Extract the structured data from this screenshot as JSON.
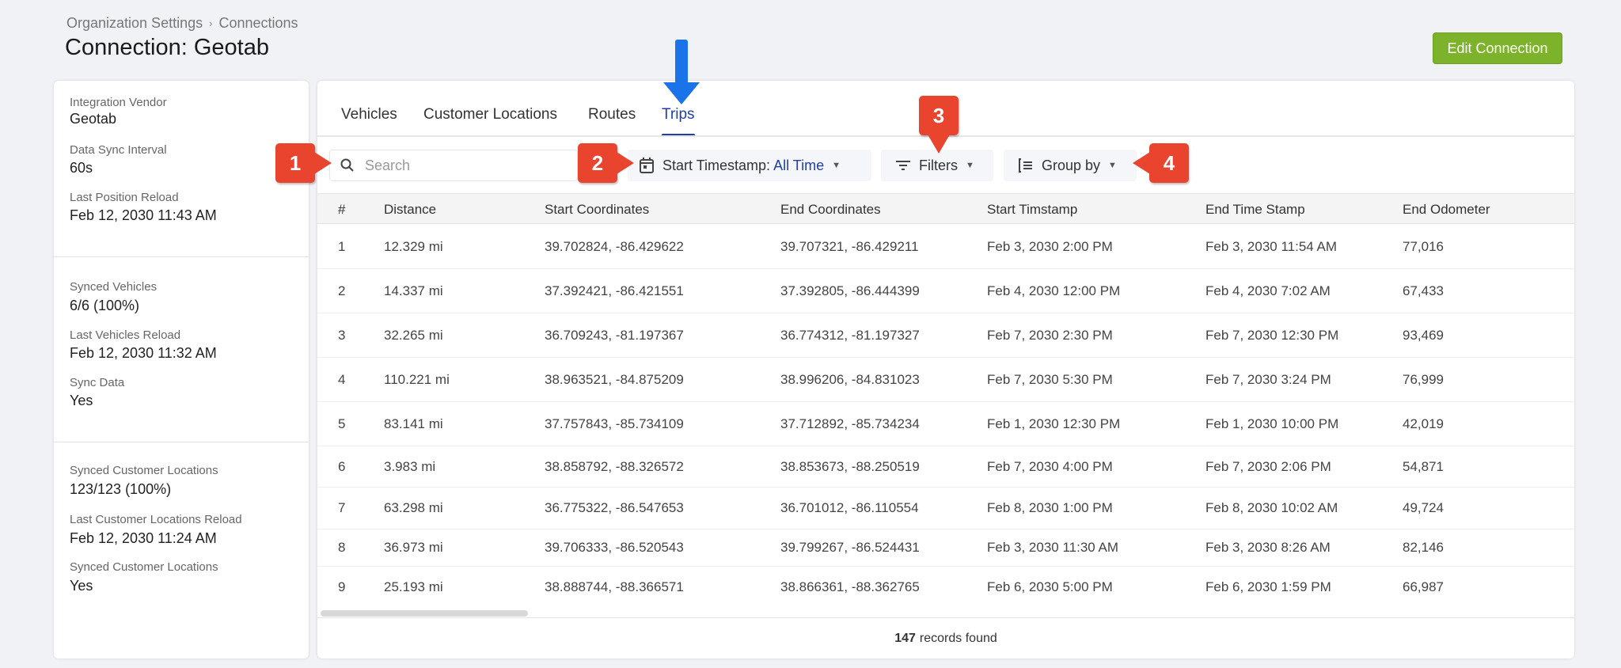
{
  "breadcrumb": [
    "Organization Settings",
    "Connections"
  ],
  "breadcrumb_separator": "›",
  "page_title": "Connection: Geotab",
  "edit_button": "Edit Connection",
  "left_panel": {
    "sections": [
      [
        {
          "label": "Integration Vendor",
          "value": "Geotab"
        },
        {
          "label": "Data Sync Interval",
          "value": "60s"
        },
        {
          "label": "Last Position Reload",
          "value": "Feb 12, 2030 11:43 AM"
        }
      ],
      [
        {
          "label": "Synced Vehicles",
          "value": "6/6 (100%)"
        },
        {
          "label": "Last Vehicles Reload",
          "value": "Feb 12, 2030 11:32 AM"
        },
        {
          "label": "Sync Data",
          "value": "Yes"
        }
      ],
      [
        {
          "label": "Synced Customer Locations",
          "value": "123/123 (100%)"
        },
        {
          "label": "Last Customer Locations Reload",
          "value": "Feb 12, 2030 11:24 AM"
        },
        {
          "label": "Synced Customer Locations",
          "value": "Yes"
        }
      ]
    ]
  },
  "tabs": [
    {
      "label": "Vehicles"
    },
    {
      "label": "Customer Locations"
    },
    {
      "label": "Routes"
    },
    {
      "label": "Trips",
      "active": true
    }
  ],
  "toolbar": {
    "search_placeholder": "Search",
    "timestamp_label": "Start Timestamp:",
    "timestamp_value": "All Time",
    "filters_label": "Filters",
    "group_by_label": "Group by"
  },
  "table": {
    "columns": [
      "#",
      "Distance",
      "Start Coordinates",
      "End Coordinates",
      "Start Timstamp",
      "End Time Stamp",
      "End Odometer"
    ],
    "rows": [
      [
        "1",
        "12.329 mi",
        "39.702824, -86.429622",
        "39.707321, -86.429211",
        "Feb 3, 2030 2:00 PM",
        "Feb 3, 2030 11:54 AM",
        "77,016"
      ],
      [
        "2",
        "14.337 mi",
        "37.392421, -86.421551",
        "37.392805, -86.444399",
        "Feb 4, 2030 12:00 PM",
        "Feb 4, 2030 7:02 AM",
        "67,433"
      ],
      [
        "3",
        "32.265 mi",
        "36.709243, -81.197367",
        "36.774312, -81.197327",
        "Feb 7, 2030 2:30 PM",
        "Feb 7, 2030 12:30 PM",
        "93,469"
      ],
      [
        "4",
        "110.221 mi",
        "38.963521, -84.875209",
        "38.996206, -84.831023",
        "Feb 7, 2030 5:30 PM",
        "Feb 7, 2030 3:24 PM",
        "76,999"
      ],
      [
        "5",
        "83.141 mi",
        "37.757843, -85.734109",
        "37.712892, -85.734234",
        "Feb 1, 2030 12:30 PM",
        "Feb 1, 2030 10:00 PM",
        "42,019"
      ],
      [
        "6",
        "3.983 mi",
        "38.858792, -88.326572",
        "38.853673, -88.250519",
        "Feb 7, 2030 4:00 PM",
        "Feb 7, 2030 2:06 PM",
        "54,871"
      ],
      [
        "7",
        "63.298 mi",
        "36.775322, -86.547653",
        "36.701012, -86.110554",
        "Feb 8, 2030 1:00 PM",
        "Feb 8, 2030 10:02 AM",
        "49,724"
      ],
      [
        "8",
        "36.973 mi",
        "39.706333, -86.520543",
        "39.799267, -86.524431",
        "Feb 3, 2030 11:30 AM",
        "Feb 3, 2030 8:26 AM",
        "82,146"
      ],
      [
        "9",
        "25.193 mi",
        "38.888744, -88.366571",
        "38.866361, -88.362765",
        "Feb 6, 2030 5:00 PM",
        "Feb 6, 2030 1:59 PM",
        "66,987"
      ]
    ]
  },
  "footer": {
    "count": "147",
    "suffix": "records found"
  },
  "annotations": [
    "1",
    "2",
    "3",
    "4"
  ],
  "colors": {
    "accent": "#1d3fa8",
    "edit_button": "#7cb32a",
    "badge": "#e8442e",
    "arrow": "#1a73e8"
  }
}
